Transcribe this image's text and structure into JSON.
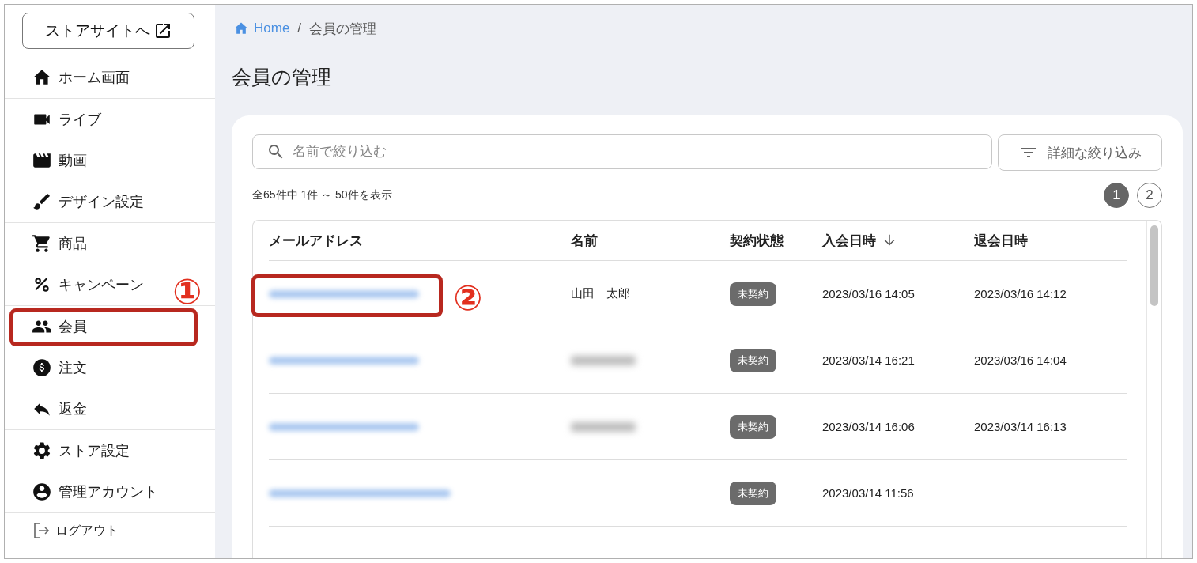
{
  "sidebar": {
    "store_button": "ストアサイトへ",
    "sections": [
      [
        {
          "label": "ホーム画面"
        }
      ],
      [
        {
          "label": "ライブ"
        },
        {
          "label": "動画"
        },
        {
          "label": "デザイン設定"
        }
      ],
      [
        {
          "label": "商品"
        },
        {
          "label": "キャンペーン"
        }
      ],
      [
        {
          "label": "会員"
        },
        {
          "label": "注文"
        },
        {
          "label": "返金"
        }
      ],
      [
        {
          "label": "ストア設定"
        },
        {
          "label": "管理アカウント"
        }
      ]
    ],
    "logout": "ログアウト"
  },
  "breadcrumb": {
    "home": "Home",
    "separator": "/",
    "current": "会員の管理"
  },
  "page_title": "会員の管理",
  "search": {
    "placeholder": "名前で絞り込む"
  },
  "filter_button": "詳細な絞り込み",
  "result_count": "全65件中 1件 ～ 50件を表示",
  "pagination": [
    {
      "label": "1",
      "selected": true
    },
    {
      "label": "2",
      "selected": false
    }
  ],
  "table": {
    "columns": [
      {
        "label": "メールアドレス",
        "sorted": false
      },
      {
        "label": "名前",
        "sorted": false
      },
      {
        "label": "契約状態",
        "sorted": false
      },
      {
        "label": "入会日時",
        "sorted": true
      },
      {
        "label": "退会日時",
        "sorted": false
      }
    ],
    "rows": [
      {
        "email_redacted": true,
        "name": "山田　太郎",
        "name_redacted": false,
        "status": "未契約",
        "joined": "2023/03/16 14:05",
        "left": "2023/03/16 14:12"
      },
      {
        "email_redacted": true,
        "name_redacted": true,
        "status": "未契約",
        "joined": "2023/03/14 16:21",
        "left": "2023/03/16 14:04"
      },
      {
        "email_redacted": true,
        "name_redacted": true,
        "status": "未契約",
        "joined": "2023/03/14 16:06",
        "left": "2023/03/14 16:13"
      },
      {
        "email_redacted": true,
        "name_redacted": false,
        "status": "未契約",
        "joined": "2023/03/14 11:56"
      }
    ]
  },
  "annotations": [
    {
      "label": "①"
    },
    {
      "label": "②"
    }
  ]
}
